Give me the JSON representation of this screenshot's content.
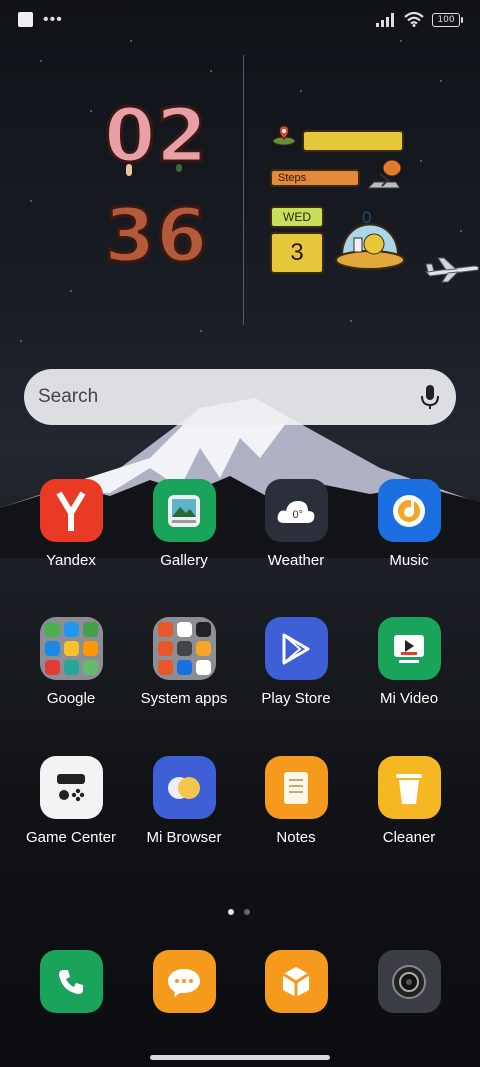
{
  "status_bar": {
    "battery": "100"
  },
  "clock": {
    "hour1": "0",
    "hour2": "2",
    "min1": "3",
    "min2": "6"
  },
  "widget": {
    "steps_label": "Steps",
    "weekday": "WED",
    "day": "3",
    "dome_count": "0"
  },
  "search": {
    "placeholder": "Search"
  },
  "apps": [
    {
      "label": "Yandex"
    },
    {
      "label": "Gallery"
    },
    {
      "label": "Weather",
      "temp": "0°"
    },
    {
      "label": "Music"
    },
    {
      "label": "Google"
    },
    {
      "label": "System apps"
    },
    {
      "label": "Play Store"
    },
    {
      "label": "Mi Video"
    },
    {
      "label": "Game Center"
    },
    {
      "label": "Mi Browser"
    },
    {
      "label": "Notes"
    },
    {
      "label": "Cleaner"
    }
  ],
  "dock": [
    {
      "icon": "phone-icon"
    },
    {
      "icon": "messages-icon"
    },
    {
      "icon": "apps-store-icon"
    },
    {
      "icon": "camera-icon"
    }
  ],
  "colors": {
    "accent_yellow": "#e6c73b",
    "accent_orange": "#e38a3a",
    "accent_green": "#c8df5a"
  }
}
